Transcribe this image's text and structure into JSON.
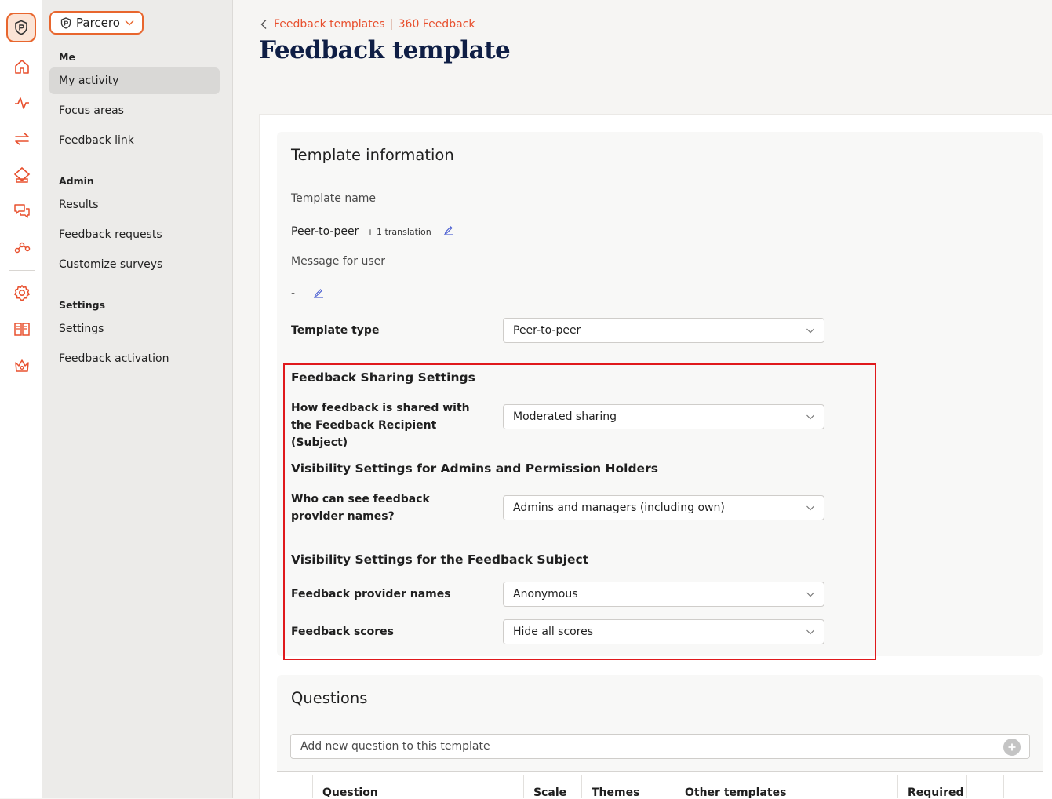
{
  "org": {
    "name": "Parcero"
  },
  "sidebar": {
    "me_label": "Me",
    "me_items": [
      "My activity",
      "Focus areas",
      "Feedback link"
    ],
    "admin_label": "Admin",
    "admin_items": [
      "Results",
      "Feedback requests",
      "Customize surveys"
    ],
    "settings_label": "Settings",
    "settings_items": [
      "Settings",
      "Feedback activation"
    ]
  },
  "breadcrumb": {
    "parent": "Feedback templates",
    "current": "360 Feedback"
  },
  "page_title": "Feedback template",
  "template_info": {
    "heading": "Template information",
    "name_label": "Template name",
    "name_value": "Peer-to-peer",
    "translation_note": "+ 1 translation",
    "message_label": "Message for user",
    "message_value": "-",
    "type_label": "Template type",
    "type_value": "Peer-to-peer"
  },
  "sharing": {
    "heading": "Feedback Sharing Settings",
    "how_shared_label": "How feedback is shared with the Feedback Recipient (Subject)",
    "how_shared_value": "Moderated sharing"
  },
  "admin_visibility": {
    "heading": "Visibility Settings for Admins and Permission Holders",
    "who_can_see_label": "Who can see feedback provider names?",
    "who_can_see_value": "Admins and managers (including own)"
  },
  "subject_visibility": {
    "heading": "Visibility Settings for the Feedback Subject",
    "provider_names_label": "Feedback provider names",
    "provider_names_value": "Anonymous",
    "scores_label": "Feedback scores",
    "scores_value": "Hide all scores"
  },
  "questions": {
    "heading": "Questions",
    "add_placeholder": "Add new question to this template",
    "columns": [
      "Question",
      "Scale",
      "Themes",
      "Other templates",
      "Required"
    ]
  },
  "colors": {
    "accent": "#e8662e",
    "title": "#0f1e45",
    "highlight": "#e0191c"
  }
}
